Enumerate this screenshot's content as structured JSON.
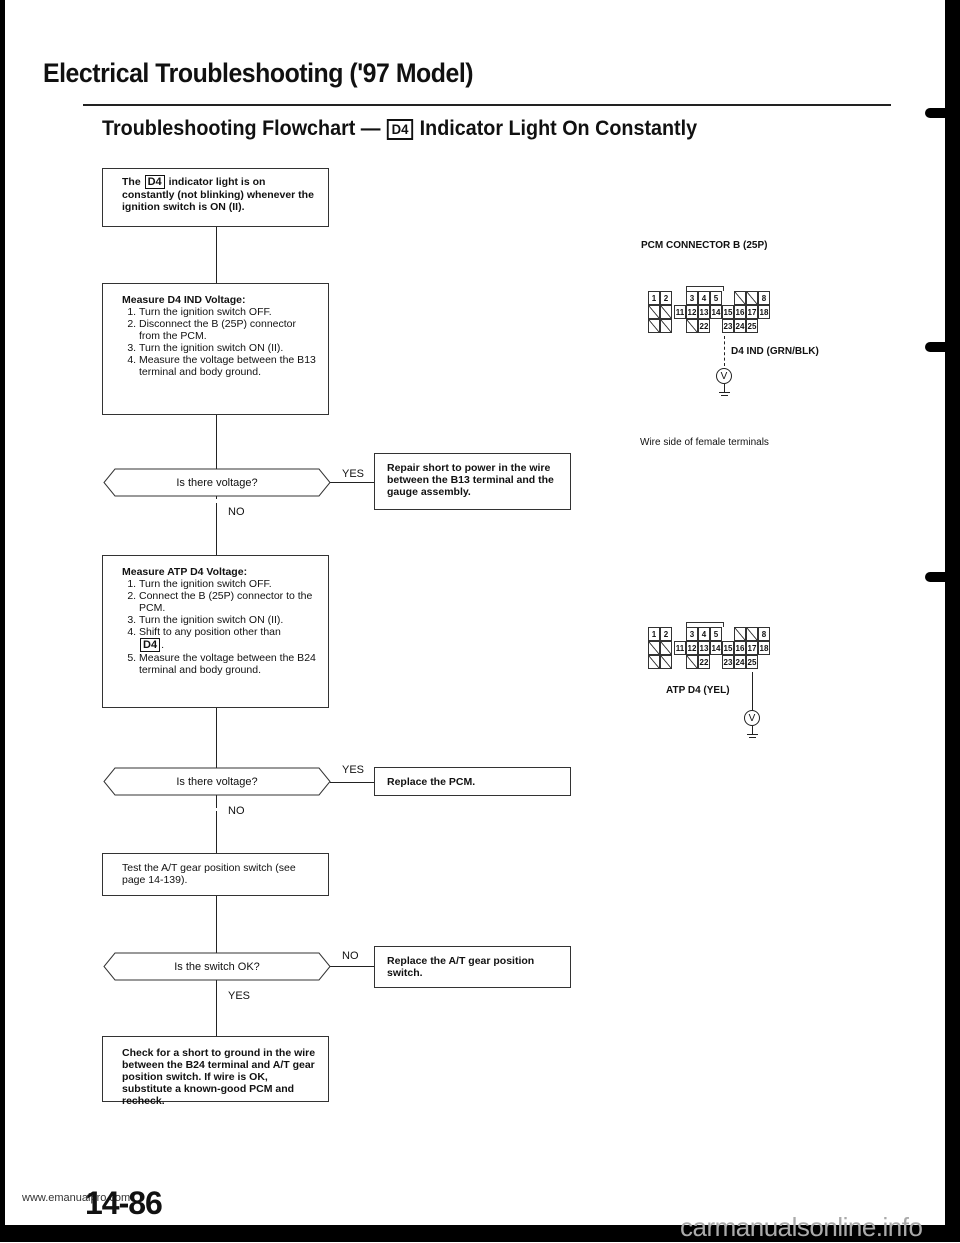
{
  "header": {
    "page_title": "Electrical Troubleshooting ('97 Model)",
    "section_title_prefix": "Troubleshooting Flowchart —",
    "section_badge": "D4",
    "section_title_suffix": "Indicator Light On Constantly"
  },
  "flowchart": {
    "start_box": {
      "text_before_badge": "The",
      "badge": "D4",
      "text_after_badge": "indicator light is on constantly (not blinking) whenever the ignition switch is ON (II)."
    },
    "step1": {
      "heading": "Measure D4 IND Voltage:",
      "steps": [
        "Turn the ignition switch OFF.",
        "Disconnect the B (25P) connector from the PCM.",
        "Turn the ignition switch ON (II).",
        "Measure the voltage between the B13 terminal and body ground."
      ]
    },
    "decision1": {
      "question": "Is there voltage?",
      "yes_label": "YES",
      "no_label": "NO",
      "yes_action": "Repair short to power in the wire between the B13 terminal and the gauge assembly."
    },
    "step2": {
      "heading": "Measure ATP D4 Voltage:",
      "steps": [
        "Turn the ignition switch OFF.",
        "Connect the B (25P) connector to the PCM.",
        "Turn the ignition switch ON (II).",
        "Shift to any position other than",
        "Measure the voltage between the B24 terminal and body ground."
      ],
      "step4_badge": "D4"
    },
    "decision2": {
      "question": "Is there voltage?",
      "yes_label": "YES",
      "no_label": "NO",
      "yes_action": "Replace the PCM."
    },
    "step3": {
      "text": "Test the A/T gear position switch (see page 14-139)."
    },
    "decision3": {
      "question": "Is the switch OK?",
      "no_label": "NO",
      "yes_label": "YES",
      "no_action": "Replace the A/T gear position switch."
    },
    "final_box": {
      "text": "Check for a short to ground in the wire between the B24 terminal and A/T gear position switch. If wire is OK, substitute a known-good PCM and recheck."
    }
  },
  "diagrams": {
    "connector_title": "PCM CONNECTOR B (25P)",
    "connector_caption": "Wire side of female terminals",
    "meter_symbol": "V",
    "connector_cells": [
      [
        "1",
        "2",
        "",
        "3",
        "4",
        "5",
        "",
        "/",
        "/",
        "8"
      ],
      [
        "/",
        "/",
        "11",
        "12",
        "13",
        "14",
        "15",
        "16",
        "17",
        "18"
      ],
      [
        "/",
        "/",
        "",
        "/",
        "22",
        "",
        "23",
        "24",
        "25",
        ""
      ]
    ],
    "diagram1_label": "D4 IND (GRN/BLK)",
    "diagram1_terminal": "13",
    "diagram2_label": "ATP D4 (YEL)",
    "diagram2_terminal": "24"
  },
  "footer": {
    "page_number": "14-86",
    "watermark_left": "www.emanualpro.com",
    "watermark_right": "carmanualsonline.info"
  }
}
